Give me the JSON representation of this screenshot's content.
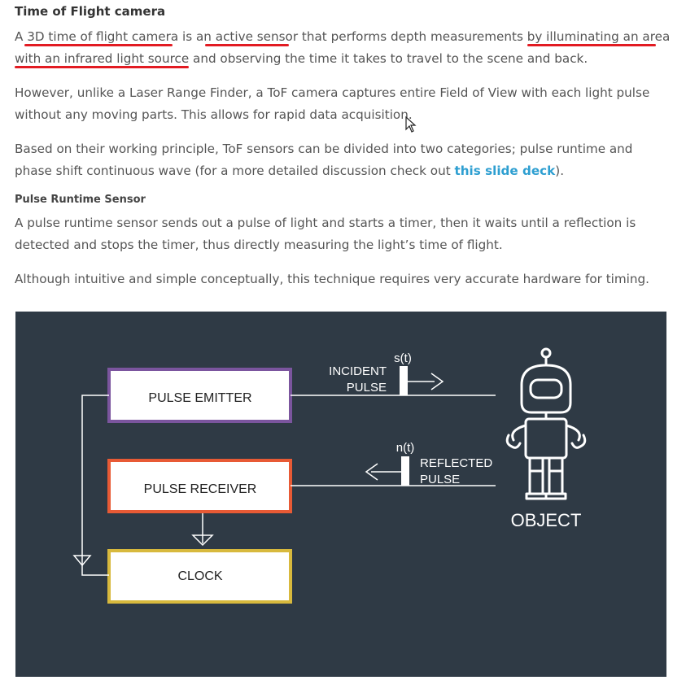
{
  "article": {
    "heading": "Time of Flight camera",
    "p1": {
      "t1": "A ",
      "hl1": "3D time of flight camera",
      "t2": " is an",
      "hl2": " active sensor",
      "t3": " that performs depth measurements by ",
      "hl3": "illuminating an area",
      "t4": " ",
      "hl4": "with an infrared light source",
      "t5": " and observing the time it takes to travel to the scene and back."
    },
    "p2": "However, unlike a Laser Range Finder, a ToF camera captures entire Field of View with each light pulse without any moving parts. This allows for rapid data acquisition.",
    "p3": {
      "before": "Based on their working principle, ToF sensors can be divided into two categories; pulse runtime and phase shift continuous wave (for a more detailed discussion check out ",
      "link": "this slide deck",
      "after": ")."
    },
    "subheading": "Pulse Runtime Sensor",
    "p4": "A pulse runtime sensor sends out a pulse of light and starts a timer, then it waits until a reflection is detected and stops the timer, thus directly measuring the light’s time of flight.",
    "p5": "Although intuitive and simple conceptually, this technique requires very accurate hardware for timing."
  },
  "diagram": {
    "emitter": "PULSE EMITTER",
    "receiver": "PULSE RECEIVER",
    "clock": "CLOCK",
    "incident_l1": "INCIDENT",
    "incident_l2": "PULSE",
    "s_t": "s(t)",
    "reflected_l1": "REFLECTED",
    "reflected_l2": "PULSE",
    "n_t": "n(t)",
    "object": "OBJECT"
  },
  "colors": {
    "diagram_bg": "#2f3a45",
    "emitter_border": "#7b559e",
    "receiver_border": "#e85a35",
    "clock_border": "#d8b93d",
    "highlight": "#e21b22",
    "link": "#2e9fd1"
  }
}
